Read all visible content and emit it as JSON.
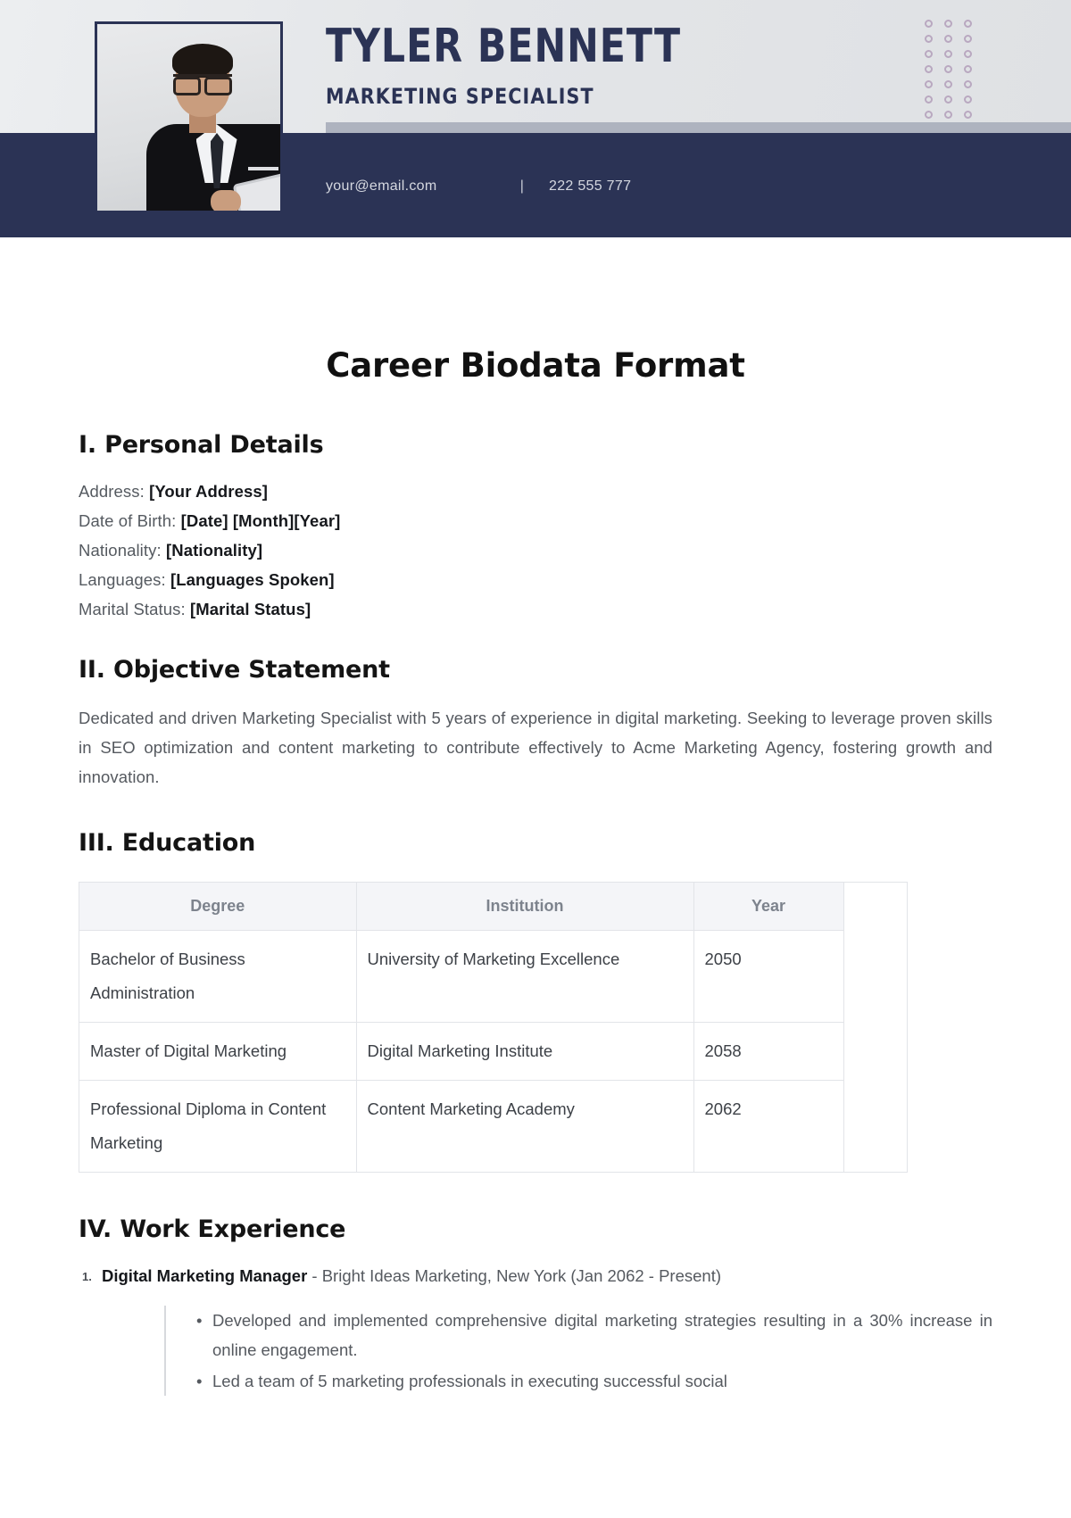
{
  "header": {
    "name": "TYLER BENNETT",
    "role": "MARKETING SPECIALIST",
    "email": "your@email.com",
    "separator": "|",
    "phone": "222 555 777",
    "navy_color": "#2b3355",
    "accent_gray": "#aeb3bf",
    "dot_color": "#b9a8c0",
    "dot_rows": 7,
    "dot_cols": 3
  },
  "document": {
    "title": "Career Biodata Format"
  },
  "personal": {
    "heading": "I. Personal Details",
    "fields": [
      {
        "label": "Address:",
        "value": "[Your Address]"
      },
      {
        "label": "Date of Birth:",
        "value": "[Date] [Month][Year]"
      },
      {
        "label": "Nationality:",
        "value": "[Nationality]"
      },
      {
        "label": "Languages:",
        "value": "[Languages Spoken]"
      },
      {
        "label": "Marital Status:",
        "value": "[Marital Status]"
      }
    ]
  },
  "objective": {
    "heading": "II. Objective Statement",
    "text": "Dedicated and driven Marketing Specialist with 5 years of experience in digital marketing. Seeking to leverage proven skills in SEO optimization and content marketing to contribute effectively to Acme Marketing Agency, fostering growth and innovation."
  },
  "education": {
    "heading": "III. Education",
    "columns": [
      "Degree",
      "Institution",
      "Year"
    ],
    "rows": [
      {
        "degree": "Bachelor of Business Administration",
        "institution": "University of Marketing Excellence",
        "year": "2050"
      },
      {
        "degree": "Master of Digital Marketing",
        "institution": "Digital Marketing Institute",
        "year": "2058"
      },
      {
        "degree": "Professional Diploma in Content Marketing",
        "institution": "Content Marketing Academy",
        "year": "2062"
      }
    ]
  },
  "work": {
    "heading": "IV. Work Experience",
    "items": [
      {
        "number": "1.",
        "role": "Digital Marketing Manager",
        "detail": " - Bright Ideas Marketing, New York (Jan 2062 - Present)",
        "bullets": [
          "Developed and implemented comprehensive digital marketing strategies resulting in a 30% increase in online engagement.",
          "Led a team of 5 marketing professionals in executing successful social"
        ]
      }
    ]
  }
}
